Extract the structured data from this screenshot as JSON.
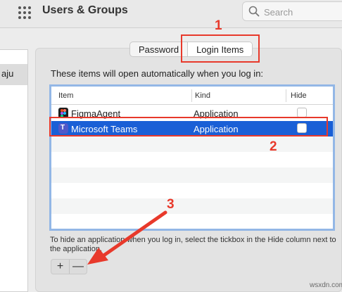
{
  "header": {
    "title": "Users & Groups",
    "search_placeholder": "Search"
  },
  "sidebar": {
    "selected_label": "aju"
  },
  "tabs": [
    {
      "label": "Password",
      "active": false
    },
    {
      "label": "Login Items",
      "active": true
    }
  ],
  "info_text": "These items will open automatically when you log in:",
  "table": {
    "columns": [
      "Item",
      "Kind",
      "Hide"
    ],
    "rows": [
      {
        "name": "FigmaAgent",
        "kind": "Application",
        "icon": "figma-icon",
        "selected": false
      },
      {
        "name": "Microsoft Teams",
        "kind": "Application",
        "icon": "teams-icon",
        "selected": true
      }
    ]
  },
  "footnote": "To hide an application when you log in, select the tickbox in the Hide column next to the application.",
  "buttons": {
    "add": "+",
    "remove": "—"
  },
  "annotations": {
    "step1": "1",
    "step2": "2",
    "step3": "3",
    "color": "#e8392b"
  },
  "watermark": "wsxdn.com",
  "colors": {
    "selection": "#1a5fd6",
    "table_focus": "#93b7e6"
  }
}
